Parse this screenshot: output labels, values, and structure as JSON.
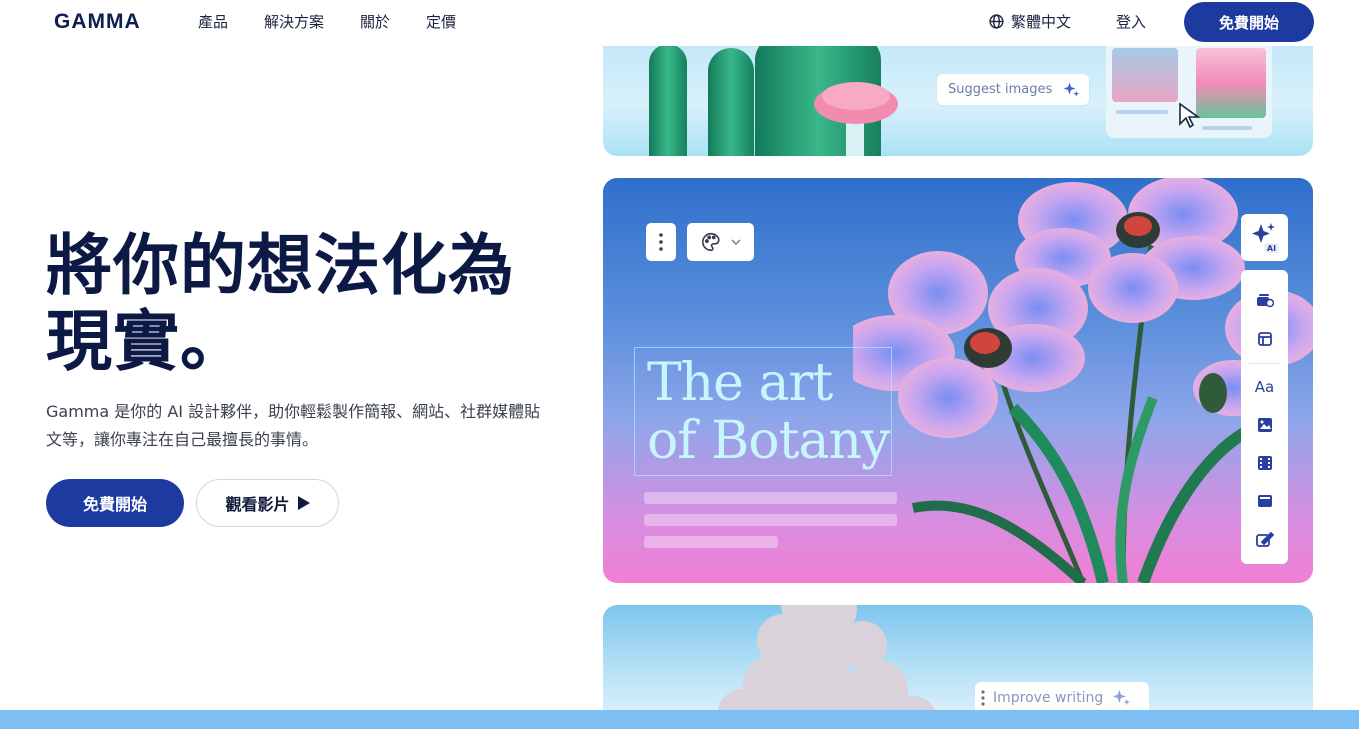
{
  "nav": {
    "logo": "GAMMA",
    "links": [
      "產品",
      "解決方案",
      "關於",
      "定價"
    ],
    "language": "繁體中文",
    "login": "登入",
    "cta": "免費開始"
  },
  "hero": {
    "headline_line1": "將你的想法化為",
    "headline_line2": "現實。",
    "subtext": "Gamma 是你的 AI 設計夥伴，助你輕鬆製作簡報、網站、社群媒體貼文等，讓你專注在自己最擅長的事情。",
    "primary_button": "免費開始",
    "secondary_button": "觀看影片"
  },
  "preview": {
    "top_card": {
      "suggest_chip": "Suggest images"
    },
    "main_card": {
      "title_line1": "The art",
      "title_line2": "of Botany",
      "ai_badge": "AI",
      "side_icons": [
        "cards-icon",
        "layout-icon",
        "text-icon",
        "image-icon",
        "video-icon",
        "embed-icon",
        "form-icon"
      ],
      "text_icon_label": "Aa"
    },
    "bottom_card": {
      "improve_chip": "Improve writing"
    }
  },
  "colors": {
    "brand": "#1d3aa0",
    "headline": "#0c1945",
    "bottom_bar": "#7dbff2",
    "botany_title": "#c8f6ff"
  }
}
